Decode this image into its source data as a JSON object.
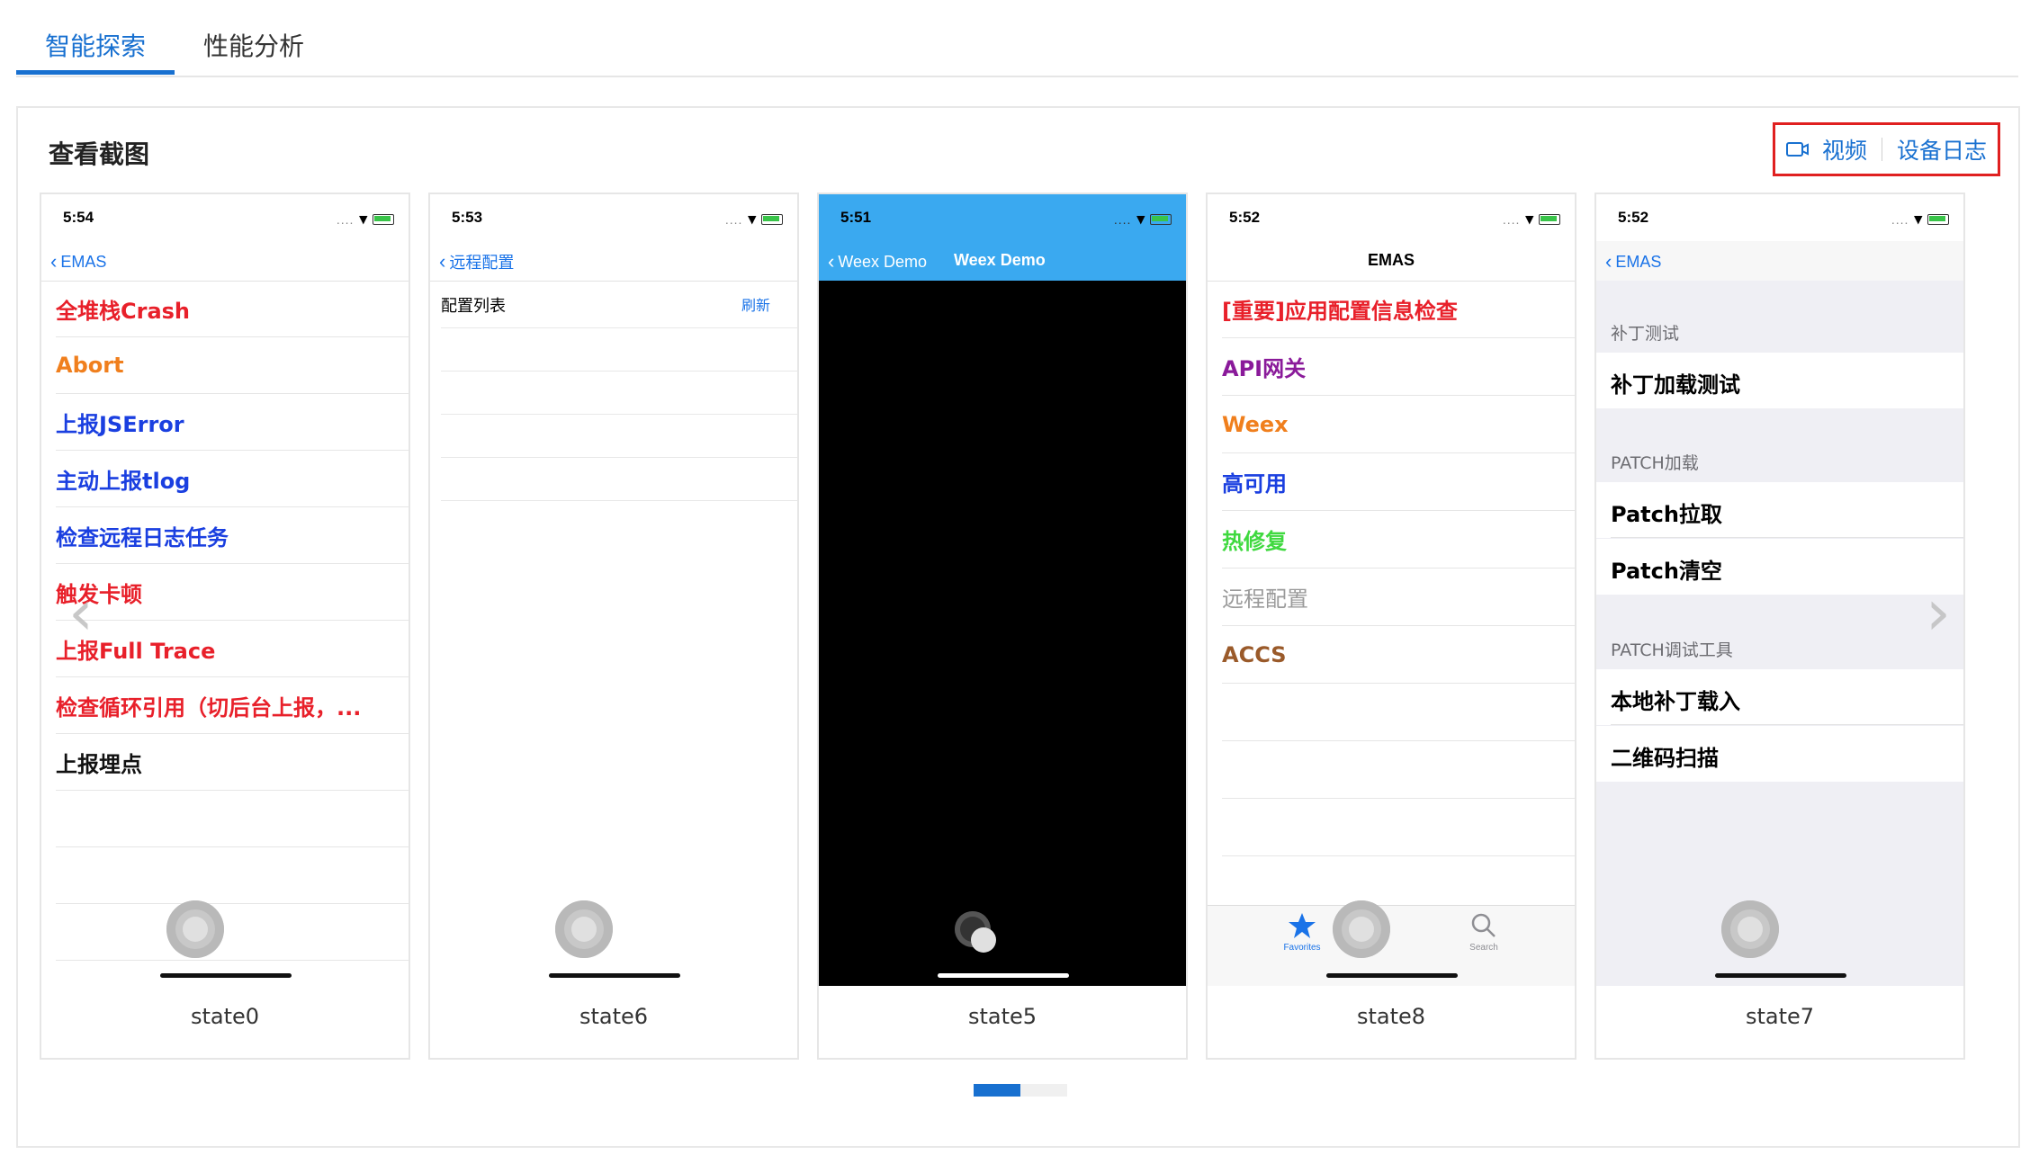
{
  "tabs": [
    {
      "label": "智能探索",
      "active": true
    },
    {
      "label": "性能分析",
      "active": false
    }
  ],
  "panel": {
    "title": "查看截图",
    "video_label": "视频",
    "device_log_label": "设备日志"
  },
  "cards": {
    "state0": {
      "time": "5:54",
      "back": "EMAS",
      "items": [
        {
          "text": "全堆栈Crash",
          "color": "#e8202a"
        },
        {
          "text": "Abort",
          "color": "#f07f1d"
        },
        {
          "text": "上报JSError",
          "color": "#1a3fe0"
        },
        {
          "text": "主动上报tlog",
          "color": "#1a3fe0"
        },
        {
          "text": "检查远程日志任务",
          "color": "#1a3fe0"
        },
        {
          "text": "触发卡顿",
          "color": "#e8202a"
        },
        {
          "text": "上报Full Trace",
          "color": "#e8202a"
        },
        {
          "text": "检查循环引用（切后台上报，...",
          "color": "#e8202a"
        },
        {
          "text": "上报埋点",
          "color": "#111111"
        }
      ],
      "caption": "state0"
    },
    "state6": {
      "time": "5:53",
      "back": "远程配置",
      "list_label": "配置列表",
      "refresh": "刷新",
      "caption": "state6"
    },
    "state5": {
      "time": "5:51",
      "back": "Weex Demo",
      "title": "Weex Demo",
      "caption": "state5"
    },
    "state8": {
      "time": "5:52",
      "title": "EMAS",
      "items": [
        {
          "text": "[重要]应用配置信息检查",
          "color": "#e8202a"
        },
        {
          "text": "API网关",
          "color": "#8a1a9a"
        },
        {
          "text": "Weex",
          "color": "#f07f1d"
        },
        {
          "text": "高可用",
          "color": "#1a3fe0"
        },
        {
          "text": "热修复",
          "color": "#3fd93f"
        },
        {
          "text": "远程配置",
          "color": "#9a9a9a"
        },
        {
          "text": "ACCS",
          "color": "#9a5a2a"
        }
      ],
      "tab_favorites": "Favorites",
      "tab_search": "Search",
      "caption": "state8"
    },
    "state7": {
      "time": "5:52",
      "back": "EMAS",
      "section1": "补丁测试",
      "row1": "补丁加载测试",
      "section2": "PATCH加载",
      "row2": "Patch拉取",
      "row3": "Patch清空",
      "section3": "PATCH调试工具",
      "row4": "本地补丁载入",
      "row5": "二维码扫描",
      "caption": "state7"
    }
  },
  "colors": {
    "accent": "#1870d0",
    "highlight_border": "#e02020"
  }
}
